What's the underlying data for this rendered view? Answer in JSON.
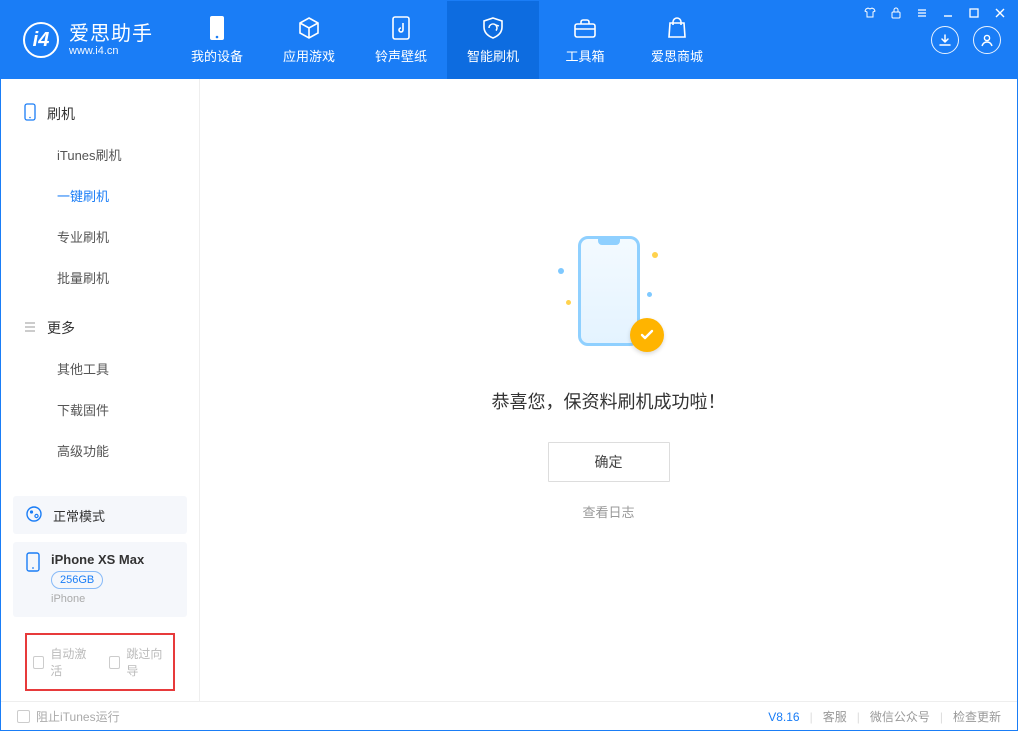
{
  "app": {
    "title": "爱思助手",
    "subtitle": "www.i4.cn"
  },
  "tabs": [
    {
      "label": "我的设备"
    },
    {
      "label": "应用游戏"
    },
    {
      "label": "铃声壁纸"
    },
    {
      "label": "智能刷机"
    },
    {
      "label": "工具箱"
    },
    {
      "label": "爱思商城"
    }
  ],
  "sidebar": {
    "group1": {
      "title": "刷机",
      "items": [
        "iTunes刷机",
        "一键刷机",
        "专业刷机",
        "批量刷机"
      ],
      "activeIndex": 1
    },
    "group2": {
      "title": "更多",
      "items": [
        "其他工具",
        "下载固件",
        "高级功能"
      ]
    }
  },
  "mode": {
    "label": "正常模式"
  },
  "device": {
    "name": "iPhone XS Max",
    "capacity": "256GB",
    "sub": "iPhone"
  },
  "options": {
    "autoActivate": "自动激活",
    "skipGuide": "跳过向导"
  },
  "main": {
    "successText": "恭喜您，保资料刷机成功啦！",
    "okLabel": "确定",
    "logLink": "查看日志"
  },
  "statusbar": {
    "blockItunes": "阻止iTunes运行",
    "version": "V8.16",
    "links": [
      "客服",
      "微信公众号",
      "检查更新"
    ]
  }
}
